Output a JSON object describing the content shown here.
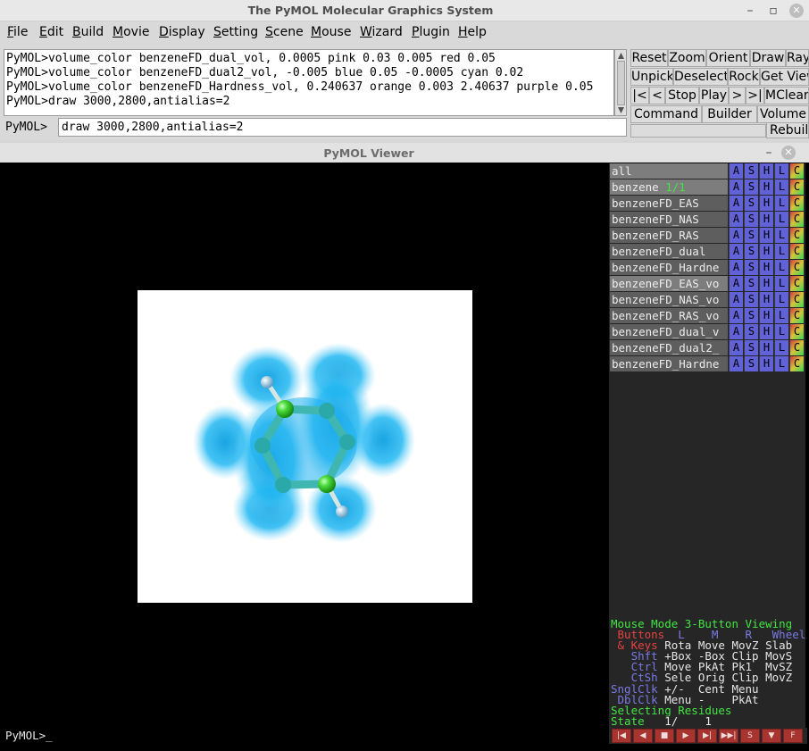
{
  "main_window": {
    "title": "The PyMOL Molecular Graphics System",
    "minimize_glyph": "–",
    "maximize_glyph": "▫",
    "close_glyph": "✕"
  },
  "menu": [
    {
      "underline": "F",
      "rest": "ile"
    },
    {
      "underline": "E",
      "rest": "dit"
    },
    {
      "underline": "B",
      "rest": "uild"
    },
    {
      "underline": "M",
      "rest": "ovie"
    },
    {
      "underline": "D",
      "rest": "isplay"
    },
    {
      "underline": "S",
      "rest": "etting"
    },
    {
      "underline": "S",
      "rest": "cene"
    },
    {
      "underline": "M",
      "rest": "ouse"
    },
    {
      "underline": "W",
      "rest": "izard"
    },
    {
      "underline": "P",
      "rest": "lugin"
    },
    {
      "underline": "H",
      "rest": "elp"
    }
  ],
  "command_log": [
    "PyMOL>volume_color benzeneFD_dual_vol, 0.0005 pink 0.03 0.005 red 0.05",
    "PyMOL>volume_color benzeneFD_dual2_vol, -0.005 blue 0.05 -0.0005 cyan 0.02",
    "PyMOL>volume_color benzeneFD_Hardness_vol, 0.240637 orange 0.003 2.40637 purple 0.05",
    "PyMOL>draw 3000,2800,antialias=2"
  ],
  "command_prompt": "PyMOL>",
  "command_input": "draw 3000,2800,antialias=2",
  "toolbar": {
    "row1": [
      "Reset",
      "Zoom",
      "Orient",
      "Draw",
      "Ray"
    ],
    "row2": [
      "Unpick",
      "Deselect",
      "Rock",
      "Get View"
    ],
    "row3": [
      "|<",
      "<",
      "Stop",
      "Play",
      ">",
      ">|",
      "MClear"
    ],
    "row4": [
      "Command",
      "Builder",
      "Volume"
    ],
    "rebuild": "Rebuild"
  },
  "viewer": {
    "title": "PyMOL Viewer",
    "close_glyph": "✕",
    "prompt": "PyMOL>_"
  },
  "objects": [
    {
      "name": "all",
      "state": "",
      "selected": true
    },
    {
      "name": "benzene ",
      "state": "1/1",
      "selected": true
    },
    {
      "name": "benzeneFD_EAS",
      "state": "",
      "selected": false
    },
    {
      "name": "benzeneFD_NAS",
      "state": "",
      "selected": false
    },
    {
      "name": "benzeneFD_RAS",
      "state": "",
      "selected": false
    },
    {
      "name": "benzeneFD_dual",
      "state": "",
      "selected": false
    },
    {
      "name": "benzeneFD_Hardne",
      "state": "",
      "selected": false
    },
    {
      "name": "benzeneFD_EAS_vo",
      "state": "",
      "selected": true
    },
    {
      "name": "benzeneFD_NAS_vo",
      "state": "",
      "selected": false
    },
    {
      "name": "benzeneFD_RAS_vo",
      "state": "",
      "selected": false
    },
    {
      "name": "benzeneFD_dual_v",
      "state": "",
      "selected": false
    },
    {
      "name": "benzeneFD_dual2_",
      "state": "",
      "selected": false
    },
    {
      "name": "benzeneFD_Hardne",
      "state": "",
      "selected": false
    }
  ],
  "object_buttons": [
    "A",
    "S",
    "H",
    "L",
    "C"
  ],
  "mouse_mode": {
    "header": "Mouse Mode 3-Button Viewing",
    "buttons_row": [
      "Buttons",
      "L",
      "M",
      "R",
      "Wheel"
    ],
    "rows": [
      {
        "key": " & Keys",
        "l": "Rota",
        "m": "Move",
        "r": "MovZ",
        "w": "Slab"
      },
      {
        "key": "   Shft",
        "l": "+Box",
        "m": "-Box",
        "r": "Clip",
        "w": "MovS"
      },
      {
        "key": "   Ctrl",
        "l": "Move",
        "m": "PkAt",
        "r": "Pk1",
        "w": "MvSZ"
      },
      {
        "key": "   CtSh",
        "l": "Sele",
        "m": "Orig",
        "r": "Clip",
        "w": "MovZ"
      },
      {
        "key": "SnglClk",
        "l": "+/-",
        "m": "Cent",
        "r": "Menu",
        "w": ""
      },
      {
        "key": " DblClk",
        "l": "Menu",
        "m": "-",
        "r": "PkAt",
        "w": ""
      }
    ],
    "selecting": "Selecting Residues",
    "state_label": "State",
    "state_value": "   1/    1"
  },
  "playbar": [
    "|◀",
    "◀",
    "■",
    "▶",
    "▶|",
    "▶▶|",
    "S",
    "▼",
    "F"
  ],
  "colors": {
    "isosurface": "#1fb8f0",
    "carbon": "#33d33a",
    "hydrogen": "#bcd6e6",
    "panel_bg": "#262626",
    "button_blue": "#6161d8"
  }
}
